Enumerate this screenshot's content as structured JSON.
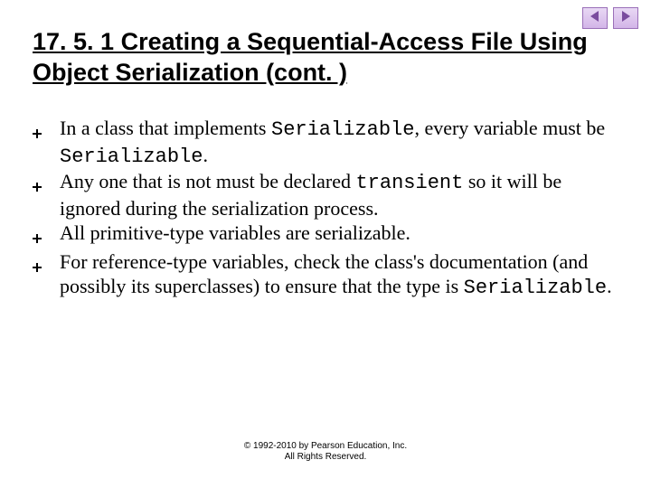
{
  "nav": {
    "prev_name": "prev-slide-button",
    "next_name": "next-slide-button"
  },
  "title": "17. 5. 1 Creating a Sequential-Access File Using Object Serialization (cont. )",
  "bullets": [
    {
      "pre": "In a class that implements ",
      "code1": "Serializable",
      "mid": ", every variable must be ",
      "code2": "Serializable",
      "post": "."
    },
    {
      "pre": "Any one that is not must be declared ",
      "code1": "transient",
      "mid": " so it will be ignored during the serialization process.",
      "code2": "",
      "post": ""
    },
    {
      "pre": "All primitive-type variables are serializable.",
      "code1": "",
      "mid": "",
      "code2": "",
      "post": ""
    },
    {
      "pre": "For reference-type variables, check the class's documentation (and possibly its superclasses) to ensure that the type is ",
      "code1": "Serializable",
      "mid": ".",
      "code2": "",
      "post": ""
    }
  ],
  "footer": {
    "line1": "© 1992-2010 by Pearson Education, Inc.",
    "line2": "All Rights Reserved."
  }
}
